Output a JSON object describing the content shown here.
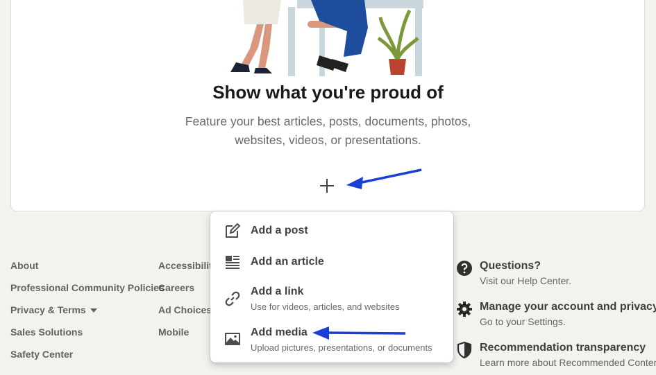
{
  "card": {
    "headline": "Show what you're proud of",
    "subtext": "Feature your best articles, posts, documents, photos, websites, videos, or presentations."
  },
  "add_menu": {
    "items": [
      {
        "title": "Add a post",
        "subtitle": "",
        "icon": "edit-icon"
      },
      {
        "title": "Add an article",
        "subtitle": "",
        "icon": "article-icon"
      },
      {
        "title": "Add a link",
        "subtitle": "Use for videos, articles, and websites",
        "icon": "link-icon"
      },
      {
        "title": "Add media",
        "subtitle": "Upload pictures, presentations, or documents",
        "icon": "image-icon"
      }
    ]
  },
  "footer": {
    "col1": [
      "About",
      "Professional Community Policies",
      "Privacy & Terms",
      "Sales Solutions",
      "Safety Center"
    ],
    "col2": [
      "Accessibility",
      "Careers",
      "Ad Choices",
      "Mobile"
    ]
  },
  "help": [
    {
      "title": "Questions?",
      "subtitle": "Visit our Help Center.",
      "icon": "question-icon"
    },
    {
      "title": "Manage your account and privacy",
      "subtitle": "Go to your Settings.",
      "icon": "gear-icon"
    },
    {
      "title": "Recommendation transparency",
      "subtitle": "Learn more about Recommended Content.",
      "icon": "shield-icon"
    }
  ],
  "colors": {
    "annotation_arrow": "#1a3fd6",
    "background": "#f4f2ee"
  }
}
